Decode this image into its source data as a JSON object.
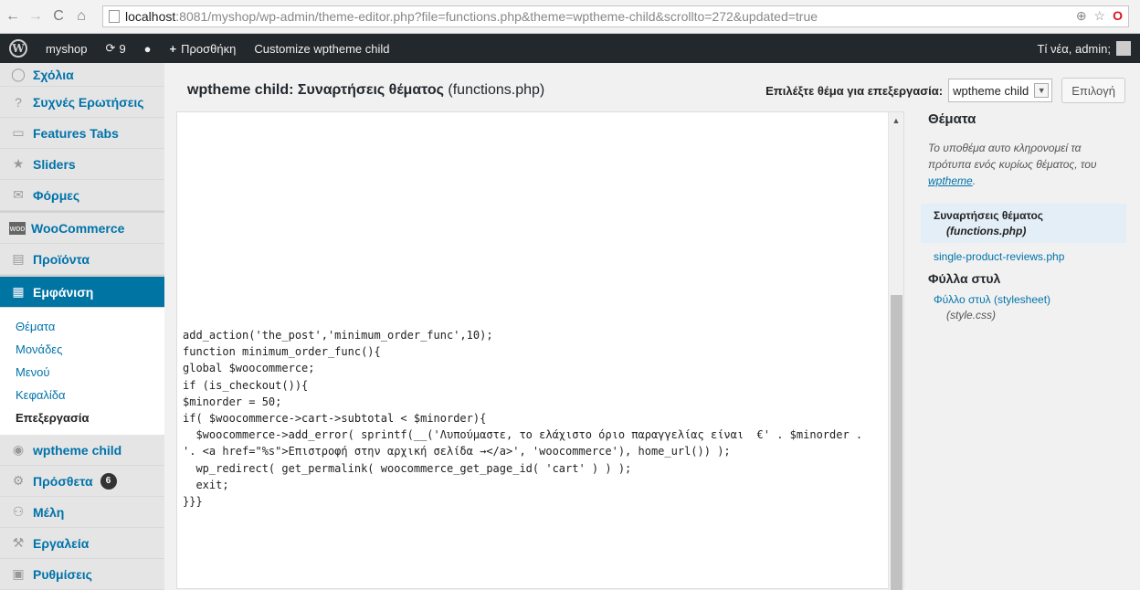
{
  "browser": {
    "url_host": "localhost",
    "url_path": ":8081/myshop/wp-admin/theme-editor.php?file=functions.php&theme=wptheme-child&scrollto=272&updated=true"
  },
  "adminbar": {
    "site_name": "myshop",
    "updates_count": "9",
    "add_new_label": "Προσθήκη",
    "customize_label": "Customize wptheme child",
    "greeting": "Τί νέα, admin;"
  },
  "sidebar": {
    "comments": "Σχόλια",
    "faq": "Συχνές Ερωτήσεις",
    "features_tabs": "Features Tabs",
    "sliders": "Sliders",
    "forms": "Φόρμες",
    "woocommerce": "WooCommerce",
    "products": "Προϊόντα",
    "appearance": "Εμφάνιση",
    "appearance_submenu": [
      "Θέματα",
      "Μονάδες",
      "Μενού",
      "Κεφαλίδα",
      "Επεξεργασία"
    ],
    "wptheme_child": "wptheme child",
    "plugins": "Πρόσθετα",
    "plugins_badge": "6",
    "users": "Μέλη",
    "tools": "Εργαλεία",
    "settings": "Ρυθμίσεις"
  },
  "main": {
    "title_theme": "wptheme child: Συναρτήσεις θέματος",
    "title_file": "(functions.php)",
    "select_label": "Επιλέξτε θέμα για επεξεργασία:",
    "select_value": "wptheme child",
    "select_button": "Επιλογή"
  },
  "editor": {
    "lines": [
      "add_action('the_post','minimum_order_func',10);",
      "function minimum_order_func(){",
      "global $woocommerce;",
      "if (is_checkout()){",
      "$minorder = 50;",
      "if( $woocommerce->cart->subtotal < $minorder){",
      "  $woocommerce->add_error( sprintf(__('Λυπούμαστε, το ελάχιστο όριο παραγγελίας είναι  €' . $minorder .",
      "'. <a href=\"%s\">Επιστροφή στην αρχική σελίδα →</a>', 'woocommerce'), home_url()) );",
      "  wp_redirect( get_permalink( woocommerce_get_page_id( 'cart' ) ) );",
      "  exit;",
      "}}}"
    ]
  },
  "templates": {
    "heading": "Θέματα",
    "description": "Το υποθέμα αυτο κληρονομεί τα πρότυπα ενός κυρίως θέματος, του",
    "parent_link": "wptheme",
    "parent_suffix": ".",
    "functions_label": "Συναρτήσεις θέματος",
    "functions_file": "(functions.php)",
    "reviews_file": "single-product-reviews.php",
    "stylesheets_heading": "Φύλλα στυλ",
    "stylesheet_label": "Φύλλο στυλ (stylesheet)",
    "stylesheet_file": "(style.css)"
  }
}
